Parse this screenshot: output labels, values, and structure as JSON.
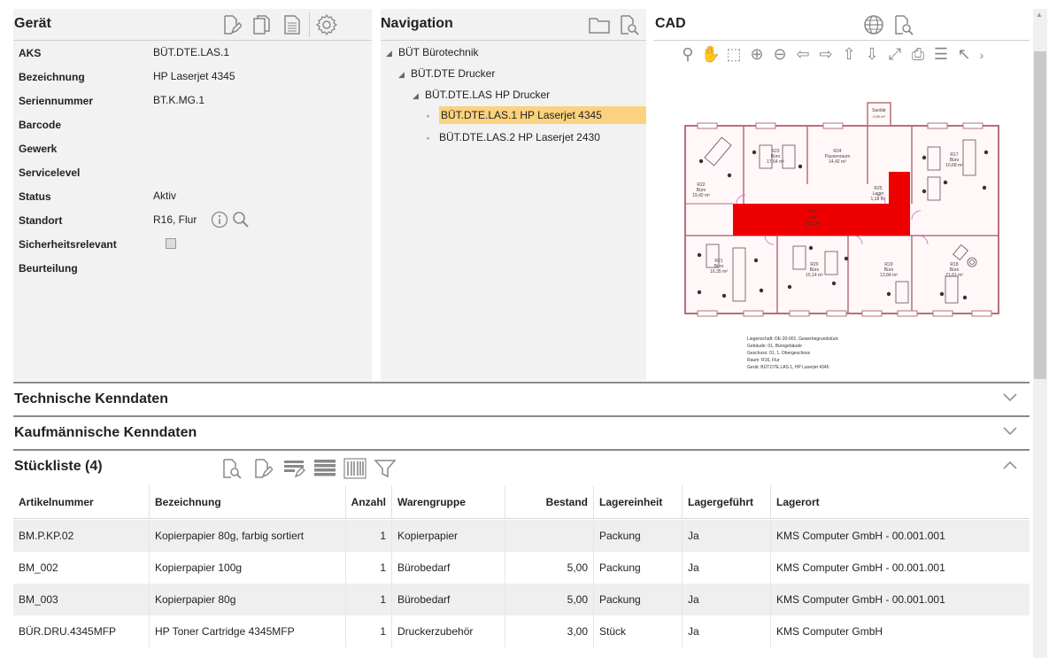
{
  "geraet": {
    "title": "Gerät",
    "fields": [
      {
        "label": "AKS",
        "value": "BÜT.DTE.LAS.1"
      },
      {
        "label": "Bezeichnung",
        "value": "HP Laserjet 4345"
      },
      {
        "label": "Seriennummer",
        "value": "BT.K.MG.1"
      },
      {
        "label": "Barcode",
        "value": ""
      },
      {
        "label": "Gewerk",
        "value": ""
      },
      {
        "label": "Servicelevel",
        "value": ""
      },
      {
        "label": "Status",
        "value": "Aktiv"
      },
      {
        "label": "Standort",
        "value": "R16, Flur"
      },
      {
        "label": "Sicherheitsrelevant",
        "value": ""
      },
      {
        "label": "Beurteilung",
        "value": ""
      }
    ]
  },
  "navigation": {
    "title": "Navigation",
    "tree": [
      {
        "label": "BÜT Bürotechnik"
      },
      {
        "label": "BÜT.DTE Drucker"
      },
      {
        "label": "BÜT.DTE.LAS HP Drucker"
      },
      {
        "label": "BÜT.DTE.LAS.1 HP Laserjet 4345",
        "selected": true
      },
      {
        "label": "BÜT.DTE.LAS.2 HP Laserjet 2430"
      }
    ]
  },
  "cad": {
    "title": "CAD",
    "rooms": {
      "r23": "R23",
      "r23_name": "Büro",
      "r23_size": "17,64 m²",
      "r24": "R24",
      "r24_name": "Pausenraum",
      "r24_size": "14,42 m²",
      "r22": "R22",
      "r22_name": "Büro",
      "r22_size": "19,42 m²",
      "r25": "R25",
      "r25_name": "Lager",
      "r25_size": "1,18 m²",
      "r17": "R17",
      "r17_name": "Büro",
      "r17_size": "10,68 m²",
      "r16": "R16",
      "r16_name": "Flur",
      "r16_size": "21,8 m²",
      "r21": "R21",
      "r21_name": "Büro",
      "r21_size": "16,35 m²",
      "r20": "R20",
      "r20_name": "Büro",
      "r20_size": "15,14 m²",
      "r19": "R19",
      "r19_name": "Büro",
      "r19_size": "13,84 m²",
      "r18": "R18",
      "r18_name": "Büro",
      "r18_size": "21,61 m²",
      "sanitar": "Sanitär",
      "sanitar_size": "0,90 m²"
    },
    "legend": [
      "Liegenschaft: DE-20-001, Gewerbegrundstück",
      "Gebäude: 01, Bürogebäude",
      "Geschoss: 01, 1. Obergeschoss",
      "Raum: R16, Flur",
      "Gerät: BÜT.DTE.LAS.1, HP Laserjet 4345"
    ]
  },
  "sections": {
    "technisch": "Technische Kenndaten",
    "kaufmaennisch": "Kaufmännische Kenndaten",
    "stueckliste": "Stückliste (4)"
  },
  "table": {
    "headers": [
      "Artikelnummer",
      "Bezeichnung",
      "Anzahl",
      "Warengruppe",
      "Bestand",
      "Lagereinheit",
      "Lagergeführt",
      "Lagerort"
    ],
    "rows": [
      [
        "BM.P.KP.02",
        "Kopierpapier 80g, farbig sortiert",
        "1",
        "Kopierpapier",
        "",
        "Packung",
        "Ja",
        "KMS Computer GmbH - 00.001.001"
      ],
      [
        "BM_002",
        "Kopierpapier 100g",
        "1",
        "Bürobedarf",
        "5,00",
        "Packung",
        "Ja",
        "KMS Computer GmbH - 00.001.001"
      ],
      [
        "BM_003",
        "Kopierpapier 80g",
        "1",
        "Bürobedarf",
        "5,00",
        "Packung",
        "Ja",
        "KMS Computer GmbH - 00.001.001"
      ],
      [
        "BÜR.DRU.4345MFP",
        "HP Toner Cartridge 4345MFP",
        "1",
        "Druckerzubehör",
        "3,00",
        "Stück",
        "Ja",
        "KMS Computer GmbH"
      ]
    ]
  },
  "colors": {
    "selected_highlight": "#fbd27f",
    "cad_flur": "#ee0000",
    "panel_bg": "#f2f2f2"
  }
}
